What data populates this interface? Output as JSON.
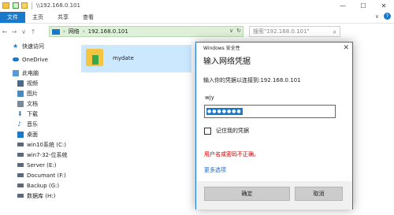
{
  "explorer": {
    "title_path": "\\\\192.168.0.101",
    "window_controls": {
      "minimize": "—",
      "maximize": "☐",
      "close": "✕"
    },
    "ribbon": {
      "tabs": [
        "文件",
        "主页",
        "共享",
        "查看"
      ],
      "expand": "∨"
    },
    "nav": {
      "back": "←",
      "forward": "→",
      "history": "∨",
      "up": "↑"
    },
    "address": {
      "network": "网络",
      "separator1": "›",
      "host": "192.168.0.101",
      "separator2": "›",
      "dropdown": "∨",
      "refresh": "↻"
    },
    "search_placeholder": "搜索\"192.168.0.101\"",
    "sidebar": {
      "items": [
        {
          "label": "快速访问",
          "icon": "star-icon",
          "color": "#1979ca"
        },
        {
          "label": "OneDrive",
          "icon": "cloud-icon",
          "color": "#1979ca"
        },
        {
          "label": "此电脑",
          "icon": "computer-icon",
          "color": "#5a9bd5"
        },
        {
          "label": "视频",
          "icon": "video-icon",
          "color": "#4a6a8a"
        },
        {
          "label": "图片",
          "icon": "pictures-icon",
          "color": "#4a88c0"
        },
        {
          "label": "文档",
          "icon": "documents-icon",
          "color": "#7a8a9a"
        },
        {
          "label": "下载",
          "icon": "download-icon",
          "color": "#1979ca"
        },
        {
          "label": "音乐",
          "icon": "music-icon",
          "color": "#1979ca"
        },
        {
          "label": "桌面",
          "icon": "desktop-icon",
          "color": "#1979ca"
        },
        {
          "label": "win10系统 (C:)",
          "icon": "drive-icon",
          "color": "#5a6a7a"
        },
        {
          "label": "win7-32-位系统",
          "icon": "drive-icon",
          "color": "#5a6a7a"
        },
        {
          "label": "Server (E:)",
          "icon": "drive-icon",
          "color": "#5a6a7a"
        },
        {
          "label": "Documant (F:)",
          "icon": "drive-icon",
          "color": "#5a6a7a"
        },
        {
          "label": "Backup (G:)",
          "icon": "drive-icon",
          "color": "#5a6a7a"
        },
        {
          "label": "数据库 (H:)",
          "icon": "drive-icon",
          "color": "#5a6a7a"
        }
      ]
    },
    "folder": {
      "name": "mydate"
    }
  },
  "dialog": {
    "title": "Windows 安全性",
    "close": "✕",
    "heading": "输入网络凭据",
    "prompt": "输入你的凭据以连接到:192.168.0.101",
    "username": "wjy",
    "password_mask": "●●●●●●●",
    "remember_label": "记住我的凭据",
    "remember_checked": false,
    "error": "用户名或密码不正确。",
    "more_options": "更多选项",
    "ok_label": "确定",
    "cancel_label": "取消",
    "accent": "#1979ca",
    "error_color": "#cc0000"
  }
}
